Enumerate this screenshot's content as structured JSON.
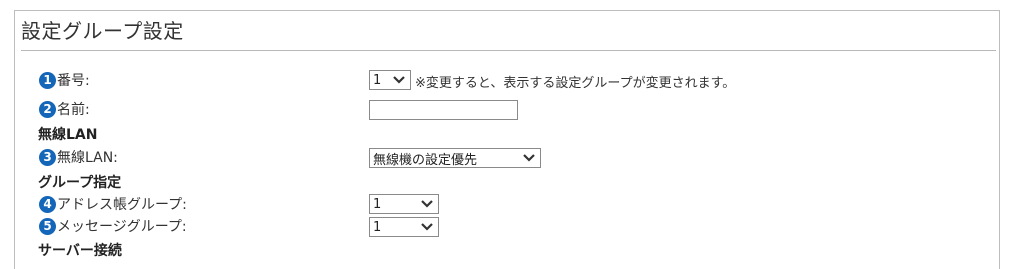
{
  "title": "設定グループ設定",
  "rows": {
    "number": {
      "badge": "1",
      "label": "番号:",
      "value": "1",
      "note": "※変更すると、表示する設定グループが変更されます。"
    },
    "name": {
      "badge": "2",
      "label": "名前:",
      "value": ""
    },
    "wireless_section": "無線LAN",
    "wireless": {
      "badge": "3",
      "label": "無線LAN:",
      "value": "無線機の設定優先"
    },
    "group_section": "グループ指定",
    "address": {
      "badge": "4",
      "label": "アドレス帳グループ:",
      "value": "1"
    },
    "message": {
      "badge": "5",
      "label": "メッセージグループ:",
      "value": "1"
    },
    "server_section": "サーバー接続"
  },
  "icons": {
    "badge_color": "#1466b8",
    "dropdown": "chevron-down-icon"
  }
}
